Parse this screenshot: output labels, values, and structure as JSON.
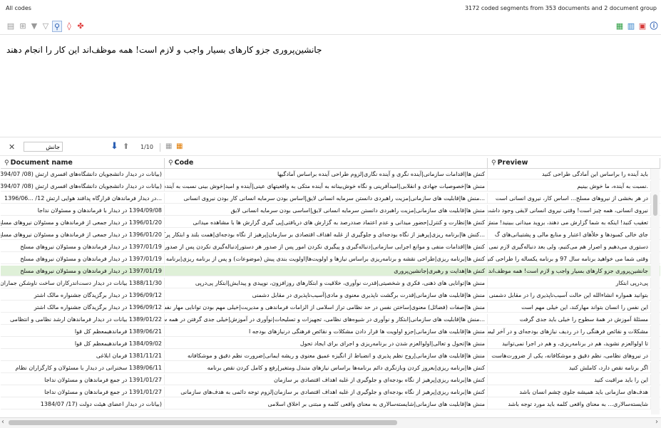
{
  "window": {
    "title": "All codes",
    "stats": "3172 coded segments from 353 documents and 2 document group"
  },
  "preview": {
    "text": "جانشین‌پروری جزو کارهای بسیار واجب و لازم است! همه موظف‌اند این کار را انجام دهند"
  },
  "search": {
    "value": "جانش",
    "page": "1/10"
  },
  "table": {
    "headers": {
      "document": "Document name",
      "code": "Code",
      "preview": "Preview"
    },
    "rows": [
      {
        "doc": "(بیانات در دیدار دانشجویان دانشگاه‌های افسری ارتش (08/ 1394/07",
        "code": "کنش ها|اقدامات سازمانی|آینده نگری و آینده نگاری|لزوم طراحی آینده براساس آمادگیها",
        "preview": "باید آینده را براساس این آمادگی طراحی کنید"
      },
      {
        "doc": "(بیانات در دیدار دانشجویان دانشگاه‌های افسری ارتش (08/ 1394/07",
        "code": "منش ها|خصوصیات جهادی و انقلابی|امیدآفرینی و نگاه خوش‌بینانه به آینده  متکی به واقعیتهای عینی|آینده و امید|خوش بینی نسبت به آینده",
        "preview": ".نسبت به آینده، ما خوش بینیم"
      },
      {
        "doc": "...در دیدار فرماندهان قرارگاه پدافند هوایی ارتش 12/ ...1396/06",
        "code": "...منش ها|قابلیت های سازمانی|مزیت راهبردی دانستن سرمایه انسانی لایق|اساس بودن سرمایه انسانی کار بودن نیروی انسانی",
        "preview": "در هر بخشی از نیروهای مسلح... اساس کار، نیروی انسانی است"
      },
      {
        "doc": "1394/09/08 در دیدار با فرماندهان و مسئولان نداجا",
        "code": "منش ها|قابلیت های سازمانی|مزیت راهبردی دانستن سرمایه انسانی لایق|اساسی بودن سرمایه انسانی لایق",
        "preview": "نیروی انسانی، همه چیز است! وقتی نیروی انسانی لایقی وجود داشت"
      },
      {
        "doc": "1396/01/20 در دیدار جمعی از فرماندهان و مسئولان نیروهای مسلح",
        "code": "کنش ها|نظارت و کنترل|حضور میدانی و عدم اعتماد صددرصد به گزارش  های دریافتی|پی گیری گزارش ها با مشاهده میدانی",
        "preview": "تعقیب کنید! اینکه به شما گزارش می دهند، بروید میدانی ببینید! منش"
      },
      {
        "doc": "1396/01/20 در دیدار جمعی از فرماندهان و مسئولان نیروهای مسلح",
        "code": "...کنش ها|برنامه ریزی|پرهیز از نگاه بودجه‌ای و جلوگیری از غلبه اهداف اقتصادی بر سازمان|پرهیز از نگاه بودجه‌ای|همت بلند و ابتکار پرکننده خلأها",
        "preview": "جای خالی کمبودها و خلأهای اعتبار و منابع مالی و پشتیبانی‌های گ"
      },
      {
        "doc": "1397/01/19 در دیدار فرماندهان و مسئولان نیروهای مسلح",
        "code": "کنش ها|اقدامات منفی و موانع اجرایی سازمانی|دنباله‌گیری و پیگیری نکردن امور پس از صدور هر دستور|دنباله‌گیری نکردن پس از صدور هر دستور",
        "preview": "دستوری می‌دهیم و اصرار هم می‌کنیم، ولی بعد دنباله‌گیری لازم نمی"
      },
      {
        "doc": "1397/01/19 در دیدار فرماندهان و مسئولان نیروهای مسلح",
        "code": "کنش ها|برنامه ریزی|طراحی نقشه و برنامه‌ریزی براساس نیازها و اولویت‌ها|اولویت بندی پیش (موضوعات) و پس از برنامه ریزی|برنامه ها و سرفص",
        "preview": "وقتی شما می خواهید برنامه سال 97 و برنامه یکساله را طراحی کنید"
      },
      {
        "doc": "1397/01/19 در دیدار فرماندهان و مسئولان نیروهای مسلح",
        "code": "کنش ها|هدایت و رهبری|جانشین‌پروری",
        "preview": "جانشین‌پروری جزو کارهای بسیار واجب و لازم است! همه موظف‌اند این کا"
      },
      {
        "doc": "1388/11/30 بیانات در دیدار دست‌اندرکاران ساخت ناوشکن جماران",
        "code": "منش ها|توانایی های ذهنی، فکری و شخصیتی|قدرت نوآوری، خلاقیت و ابتکارهای روزافزون، نوپیدی و پیدایش|ابتکار پی‌درپی",
        "preview": "پی‌درپی ابتکار"
      },
      {
        "doc": "1396/09/12 در دیدار برگزیدگان جشنواره مالک اشتر",
        "code": "منش ها|قابلیت های سازمانی|قدرت برگشت ناپذیری معنوی و مادی|آسیب‌ناپذیری در مقابل دشمنی",
        "preview": "بتوانید همواره انشاءالله این حالت آسیب‌ناپذیری را در مقابل دشمنی"
      },
      {
        "doc": "1396/09/12 در دیدار برگزیدگان جشنواره مالک اشتر",
        "code": "منش ها|صفات (فضائل) معنوی|ساختن نفس در حد نظامی تراز اسلامی از الزامات فرماندهی و مدیریت|خیلی مهم بودن توانایی مهار نفس",
        "preview": "این نفس را انسان بتواند مهارکند، این خیلی مهم است"
      },
      {
        "doc": "1389/01/22 بیانات در دیدار فرماندهان ارشد نظامی و انتظامی",
        "code": "...منش ها|قابلیت های سازمانی|ابتکار و نوآوری در شیوه‌های نظامی، تجهیزات و تسلیحات|نوآوری در آموزش|خیلی جدی گرفتن در همه س",
        "preview": "مسئلهٔ آموزش در همهٔ سطوح را خیلی باید جدی گرفت"
      },
      {
        "doc": "1389/06/21 فرماندهیمعظم کل قوا",
        "code": "منش ها|قابلیت های سازمانی|جزو اولویت ها قرار دادن مشکلات و نقائص فرهنگی درنیازهای بودجه ا",
        "preview": "مشکلات و نقائص فرهنگی را در ردیف نیازهای بودجه‌ای و در آخر لیست"
      },
      {
        "doc": "1384/09/02 فرماندهیمعظم کل قوا",
        "code": "منش ها|تحول و تعالی|اولوالعزم شدن در برنامه‌ریزی و اجرای برای ایجاد تحول",
        "preview": "تا اولوالعزم نشوید، هم در برنامه‌ریزی، و هم در اجرا نمی‌توانید"
      },
      {
        "doc": "1381/11/21 فرمان ابلاغی",
        "code": "منش ها|قابلیت های سازمانی|روح نظم پذیری و انضباط از انگیزه عمیق معنوی و ریشه ایمانی|ضرورت نظم دقیق و موشکافانه",
        "preview": "در نیروهای نظامی، نظم دقیق و موشکافانه، یکی از ضرورت‌هاست"
      },
      {
        "doc": "1389/06/11 سخنرانی در دیدار با مسئولان و کارگزاران نظام",
        "code": "کنش ها|برنامه ریزی|بعروز کردن وبازنگری دائم برنامه‌ها براساس نیازهای متبدل ومتغیر|رفع و کامل کردن نقص برنامه",
        "preview": "اگر برنامه نقص دارد، کاملش کنید"
      },
      {
        "doc": "1391/01/27 در جمع فرماندهان و مسئولان نداجا",
        "code": "کنش ها|برنامه ریزی|پرهیز از نگاه بودجه‌ای و جلوگیری از غلبه اهداف اقتصادی بر سازمان",
        "preview": "این را باید مراقبت کنید"
      },
      {
        "doc": "1391/01/27 در جمع فرماندهان و مسئولان نداجا",
        "code": "کنش ها|برنامه ریزی|پرهیز از نگاه بودجه‌ای و جلوگیری از غلبه اهداف اقتصادی بر سازمان|لزوم توجه دائمی به هدف‌های سازمانی",
        "preview": "هدف‌های سازمانی باید همیشه جلوی چشم انسان باشد"
      },
      {
        "doc": "(بیانات در دیدار اعضای هیئت دولت (17/ 1384/07",
        "code": "منش ها|قابلیت های سازمانی|شایسته‌سالاری به معنای واقعی کلمه و مبتنی بر اخلاق اسلامی",
        "preview": "شایسته‌سالاری... به معنای واقعی کلمه باید مورد توجه باشد"
      }
    ]
  },
  "colors": {
    "selected_row": "#dff0d8",
    "highlight": "#ffd24d",
    "accent": "#2b5fb3"
  }
}
